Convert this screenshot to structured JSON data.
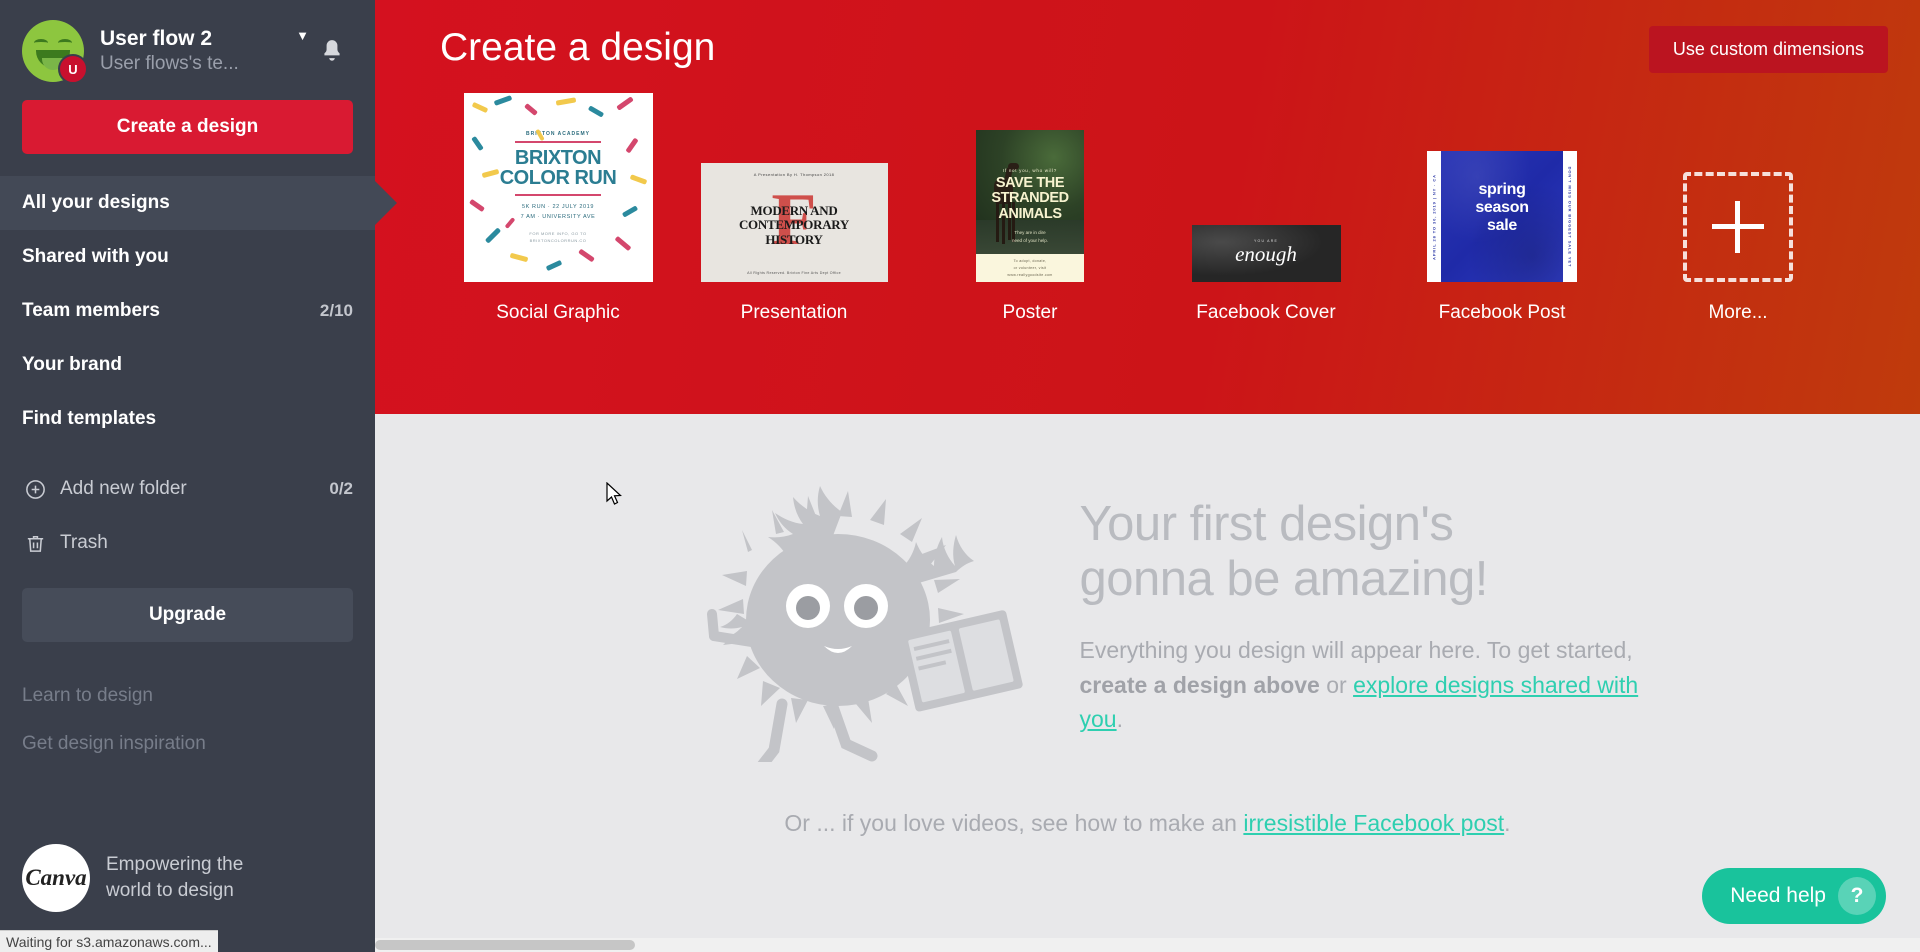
{
  "sidebar": {
    "account": {
      "name": "User flow 2",
      "subtitle": "User flows's te...",
      "avatar_badge": "U",
      "caret_icon": "chevron-down-icon",
      "bell_icon": "bell-icon"
    },
    "create_button": "Create a design",
    "nav_items": [
      {
        "label": "All your designs",
        "badge": "",
        "active": true
      },
      {
        "label": "Shared with you",
        "badge": "",
        "active": false
      },
      {
        "label": "Team members",
        "badge": "2/10",
        "active": false
      },
      {
        "label": "Your brand",
        "badge": "",
        "active": false
      },
      {
        "label": "Find templates",
        "badge": "",
        "active": false
      }
    ],
    "folder_items": [
      {
        "label": "Add new folder",
        "badge": "0/2",
        "icon": "plus-circle-icon"
      },
      {
        "label": "Trash",
        "badge": "",
        "icon": "trash-icon"
      }
    ],
    "upgrade_button": "Upgrade",
    "links": [
      "Learn to design",
      "Get design inspiration"
    ],
    "brand": {
      "logo_text": "Canva",
      "tagline_line1": "Empowering the",
      "tagline_line2": "world to design"
    }
  },
  "hero": {
    "title": "Create a design",
    "custom_button": "Use custom dimensions",
    "cards": [
      {
        "label": "Social Graphic",
        "thumb": {
          "kind": "social-graphic",
          "academy": "BRIXTON ACADEMY",
          "title_line1": "BRIXTON",
          "title_line2": "COLOR RUN",
          "info_line1": "5K RUN  ·  22 JULY 2019",
          "info_line2": "7 AM  ·  UNIVERSITY AVE",
          "footer_line1": "FOR MORE INFO, GO TO",
          "footer_line2": "BRIXTONCOLORRUN.CO"
        }
      },
      {
        "label": "Presentation",
        "thumb": {
          "kind": "presentation",
          "top_note": "A Presentation By H. Thompson 2018",
          "big_letter": "F",
          "title_line1": "MODERN AND",
          "title_line2": "CONTEMPORARY",
          "title_line3": "HISTORY",
          "bottom_note": "All Rights Reserved. Brixton Fine Arts Dept Office"
        }
      },
      {
        "label": "Poster",
        "thumb": {
          "kind": "poster",
          "kicker": "If not you, who will?",
          "title_line1": "SAVE THE",
          "title_line2": "STRANDED",
          "title_line3": "ANIMALS",
          "sub_line1": "They are in dire",
          "sub_line2": "need of your help.",
          "footer_line1": "To adopt, donate,",
          "footer_line2": "or volunteer, visit",
          "footer_line3": "www.reallygoodsite.com"
        }
      },
      {
        "label": "Facebook Cover",
        "thumb": {
          "kind": "facebook-cover",
          "kicker": "YOU ARE",
          "word": "enough"
        }
      },
      {
        "label": "Facebook Post",
        "thumb": {
          "kind": "facebook-post",
          "strip_left": "APRIL 28 TO 30, 2019 | NY · CA",
          "strip_right": "DON'T MISS OUR BIGGEST SALE YET",
          "title_line1": "spring",
          "title_line2": "season",
          "title_line3": "sale"
        }
      },
      {
        "label": "More...",
        "thumb": {
          "kind": "more",
          "icon": "plus-icon"
        }
      }
    ]
  },
  "empty_state": {
    "heading_line1": "Your first design's",
    "heading_line2": "gonna be amazing!",
    "paragraph_1": "Everything you design will appear here. To get",
    "paragraph_2_pre": "started, ",
    "paragraph_2_bold": "create a design above",
    "paragraph_2_mid": " or ",
    "paragraph_2_link": "explore designs shared with you",
    "paragraph_2_end": ".",
    "bottom_pre": "Or ... if you love videos, see how to make an ",
    "bottom_link": "irresistible Facebook post",
    "bottom_end": ".",
    "mascot_icon": "fluffy-mascot-illustration"
  },
  "need_help": {
    "label": "Need help",
    "icon": "question-mark-icon"
  },
  "statusbar": {
    "text": "Waiting for s3.amazonaws.com..."
  },
  "colors": {
    "sidebar_bg": "#3a3f4b",
    "hero_red": "#cc1418",
    "accent_red": "#d91a32",
    "link_teal": "#2ecfb0",
    "help_green": "#19c39c",
    "content_bg": "#e8e8ea"
  }
}
